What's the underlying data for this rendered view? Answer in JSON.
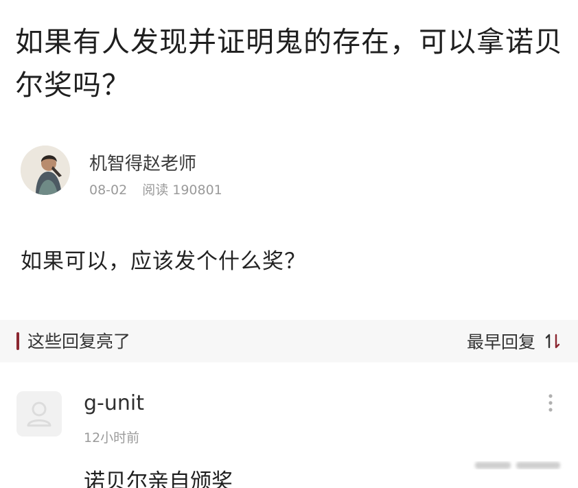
{
  "question": {
    "title": "如果有人发现并证明鬼的存在，可以拿诺贝尔奖吗？",
    "body": "如果可以，应该发个什么奖？"
  },
  "author": {
    "name": "机智得赵老师",
    "date": "08-02",
    "read_label": "阅读",
    "read_count": "190801",
    "avatar_icon": "person-photo-avatar"
  },
  "replies": {
    "section_title": "这些回复亮了",
    "sort_label": "最早回复",
    "sort_icon": "sort-arrows-icon",
    "accent_color": "#8b2630"
  },
  "comments": [
    {
      "user": "g-unit",
      "time": "12小时前",
      "text": "诺贝尔亲自颁奖",
      "avatar_icon": "default-user-avatar-icon",
      "more_icon": "more-vertical-icon"
    }
  ]
}
